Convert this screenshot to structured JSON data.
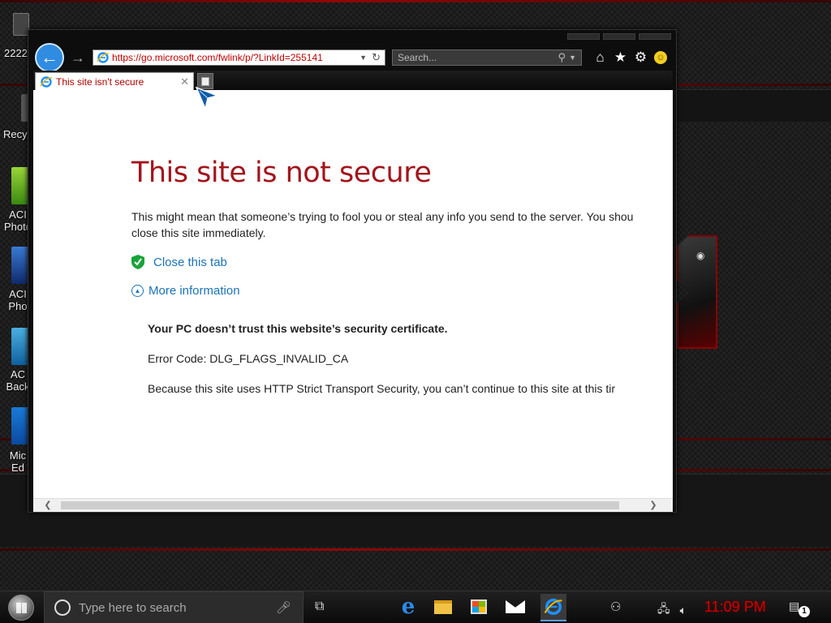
{
  "desktop": {
    "icons": [
      {
        "label": "2222"
      },
      {
        "label": "Recy"
      },
      {
        "label": "ACI\nPhoto"
      },
      {
        "label": "ACI\nPho"
      },
      {
        "label": "AC\nBack"
      },
      {
        "label": "Mic\nEd"
      }
    ]
  },
  "browser": {
    "address_url": "https://go.microsoft.com/fwlink/p/?LinkId=255141",
    "search_placeholder": "Search...",
    "tab_title": "This site isn't secure",
    "icons": [
      "back-arrow-icon",
      "forward-arrow-icon",
      "home-icon",
      "favorites-star-icon",
      "settings-gear-icon",
      "smiley-feedback-icon"
    ]
  },
  "error_page": {
    "title": "This site is not secure",
    "body_line1": "This might mean that someone’s trying to fool you or steal any info you send to the server. You shou",
    "body_line2": "close this site immediately.",
    "close_tab_label": "Close this tab",
    "more_info_label": "More information",
    "trust_message": "Your PC doesn’t trust this website’s security certificate.",
    "error_code": "Error Code: DLG_FLAGS_INVALID_CA",
    "hsts_message": "Because this site uses HTTP Strict Transport Security, you can’t continue to this site at this tir"
  },
  "taskbar": {
    "search_placeholder": "Type here to search",
    "clock": "11:09 PM",
    "notification_count": "1",
    "pinned_apps": [
      "edge-icon",
      "file-explorer-icon",
      "store-icon",
      "mail-icon",
      "internet-explorer-icon"
    ]
  },
  "colors": {
    "error_title": "#a3141c",
    "link": "#1a73b7",
    "clock": "#d00000",
    "url": "#c00000"
  }
}
